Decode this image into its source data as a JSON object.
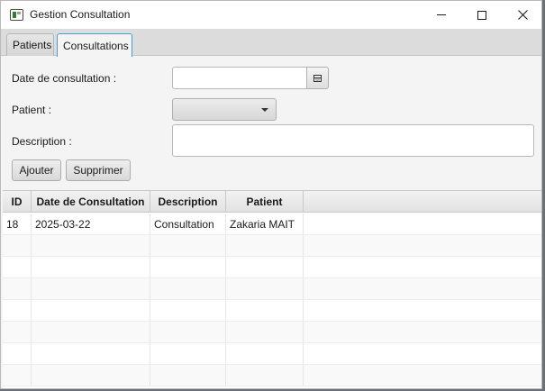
{
  "window": {
    "title": "Gestion Consultation",
    "icons": {
      "app": "app-window-icon",
      "minimize": "minimize-icon",
      "maximize": "maximize-icon",
      "close": "close-icon"
    }
  },
  "tabs": [
    {
      "label": "Patients",
      "selected": false
    },
    {
      "label": "Consultations",
      "selected": true
    }
  ],
  "form": {
    "date_label": "Date de consultation :",
    "date_value": "",
    "patient_label": "Patient :",
    "patient_value": "",
    "description_label": "Description :",
    "description_value": "",
    "add_button": "Ajouter",
    "delete_button": "Supprimer"
  },
  "table": {
    "columns": [
      "ID",
      "Date de Consultation",
      "Description",
      "Patient"
    ],
    "rows": [
      [
        "18",
        "2025-03-22",
        "Consultation",
        "Zakaria MAIT"
      ]
    ]
  },
  "colors": {
    "accent": "#3ea2d8",
    "background": "#f4f4f4",
    "table_background": "#ffffff"
  }
}
